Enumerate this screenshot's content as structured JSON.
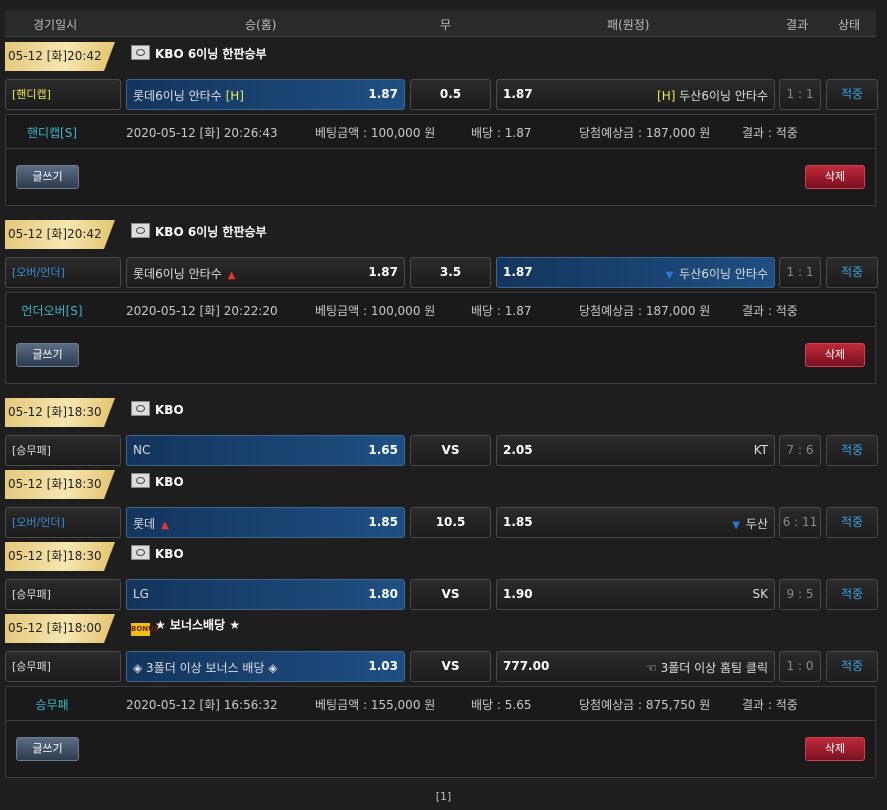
{
  "header": {
    "date": "경기일시",
    "home": "승(홈)",
    "draw": "무",
    "away": "패(원정)",
    "result": "결과",
    "status": "상태"
  },
  "games": [
    {
      "date": "05-12 [화]20:42",
      "league": "KBO 6이닝 한판승부",
      "flag": "flag",
      "type": "[핸디캡]",
      "type_color": "#e8e85a",
      "home": "롯데6이닝 안타수",
      "home_tag": "[H]",
      "home_arrow": "",
      "home_odd": "1.87",
      "mid": "0.5",
      "away": "두산6이닝 안타수",
      "away_tag": "[H]",
      "away_arrow": "",
      "away_odd": "1.87",
      "score": "1 : 1",
      "status": "적중",
      "selected": "home"
    },
    {
      "date": "05-12 [화]20:42",
      "league": "KBO 6이닝 한판승부",
      "flag": "flag",
      "type": "[오버/언더]",
      "type_color": "#3a8ad8",
      "home": "롯데6이닝 안타수",
      "home_tag": "",
      "home_arrow": "▲",
      "home_odd": "1.87",
      "mid": "3.5",
      "away": "두산6이닝 안타수",
      "away_tag": "",
      "away_arrow": "▼",
      "away_odd": "1.87",
      "score": "1 : 1",
      "status": "적중",
      "selected": "away"
    },
    {
      "date": "05-12 [화]18:30",
      "league": "KBO",
      "flag": "flag",
      "type": "[승무패]",
      "type_color": "#dddddd",
      "home": "NC",
      "home_tag": "",
      "home_arrow": "",
      "home_odd": "1.65",
      "mid": "VS",
      "away": "KT",
      "away_tag": "",
      "away_arrow": "",
      "away_odd": "2.05",
      "score": "7 : 6",
      "status": "적중",
      "selected": "home"
    },
    {
      "date": "05-12 [화]18:30",
      "league": "KBO",
      "flag": "flag",
      "type": "[오버/언더]",
      "type_color": "#3a8ad8",
      "home": "롯데",
      "home_tag": "",
      "home_arrow": "▲",
      "home_odd": "1.85",
      "mid": "10.5",
      "away": "두산",
      "away_tag": "",
      "away_arrow": "▼",
      "away_odd": "1.85",
      "score": "6 : 11",
      "status": "적중",
      "selected": "home"
    },
    {
      "date": "05-12 [화]18:30",
      "league": "KBO",
      "flag": "flag",
      "type": "[승무패]",
      "type_color": "#dddddd",
      "home": "LG",
      "home_tag": "",
      "home_arrow": "",
      "home_odd": "1.80",
      "mid": "VS",
      "away": "SK",
      "away_tag": "",
      "away_arrow": "",
      "away_odd": "1.90",
      "score": "9 : 5",
      "status": "적중",
      "selected": "home"
    },
    {
      "date": "05-12 [화]18:00",
      "league": "★ 보너스배당 ★",
      "flag": "bonus",
      "flag_text": "BONUS",
      "type": "[승무패]",
      "type_color": "#dddddd",
      "home": "◈ 3폴더 이상 보너스 배당 ◈",
      "home_tag": "",
      "home_arrow": "",
      "home_odd": "1.03",
      "mid": "VS",
      "away": "☜ 3폴더 이상 홈팀 클릭",
      "away_tag": "",
      "away_arrow": "",
      "away_odd": "777.00",
      "score": "1 : 0",
      "status": "적중",
      "selected": "home"
    }
  ],
  "bets": [
    {
      "type": "핸디캡[S]",
      "time": "2020-05-12 [화] 20:26:43",
      "amount": "베팅금액 : 100,000 원",
      "odds": "배당 : 1.87",
      "win": "당첨예상금 : 187,000 원",
      "result": "결과 : 적중"
    },
    {
      "type": "언더오버[S]",
      "time": "2020-05-12 [화] 20:22:20",
      "amount": "베팅금액 : 100,000 원",
      "odds": "배당 : 1.87",
      "win": "당첨예상금 : 187,000 원",
      "result": "결과 : 적중"
    },
    {
      "type": "승무패",
      "time": "2020-05-12 [화] 16:56:32",
      "amount": "베팅금액 : 155,000 원",
      "odds": "배당 : 5.65",
      "win": "당첨예상금 : 875,750 원",
      "result": "결과 : 적중"
    }
  ],
  "buttons": {
    "write": "글쓰기",
    "delete": "삭제"
  },
  "pagination": "[1]"
}
